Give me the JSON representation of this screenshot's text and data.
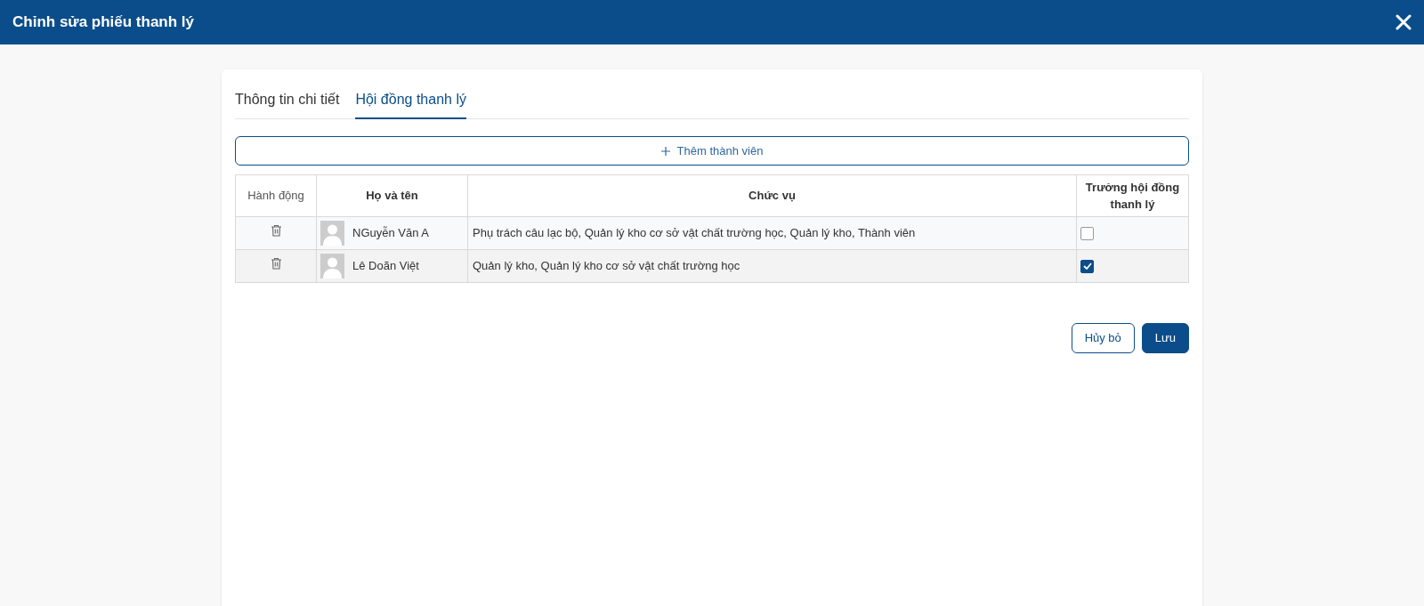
{
  "window": {
    "title": "Chỉnh sửa phiếu thanh lý"
  },
  "tabs": [
    {
      "label": "Thông tin chi tiết",
      "selected": false
    },
    {
      "label": "Hội đồng thanh lý",
      "selected": true
    }
  ],
  "add_button": {
    "label": "Thêm thành viên"
  },
  "table": {
    "columns": [
      "Hành động",
      "Họ và tên",
      "Chức vụ",
      "Trưởng hội đồng thanh lý"
    ],
    "rows": [
      {
        "name": "NGuyễn Văn A",
        "position": "Phụ trách câu lạc bộ, Quản lý kho cơ sở vật chất trường học, Quản lý kho, Thành viên",
        "checked": false
      },
      {
        "name": "Lê Doãn Việt",
        "position": "Quản lý kho, Quản lý kho cơ sở vật chất trường học",
        "checked": true
      }
    ]
  },
  "buttons": [
    {
      "label": "Hủy bỏ",
      "kind": "secondary"
    },
    {
      "label": "Lưu",
      "kind": "primary"
    }
  ]
}
